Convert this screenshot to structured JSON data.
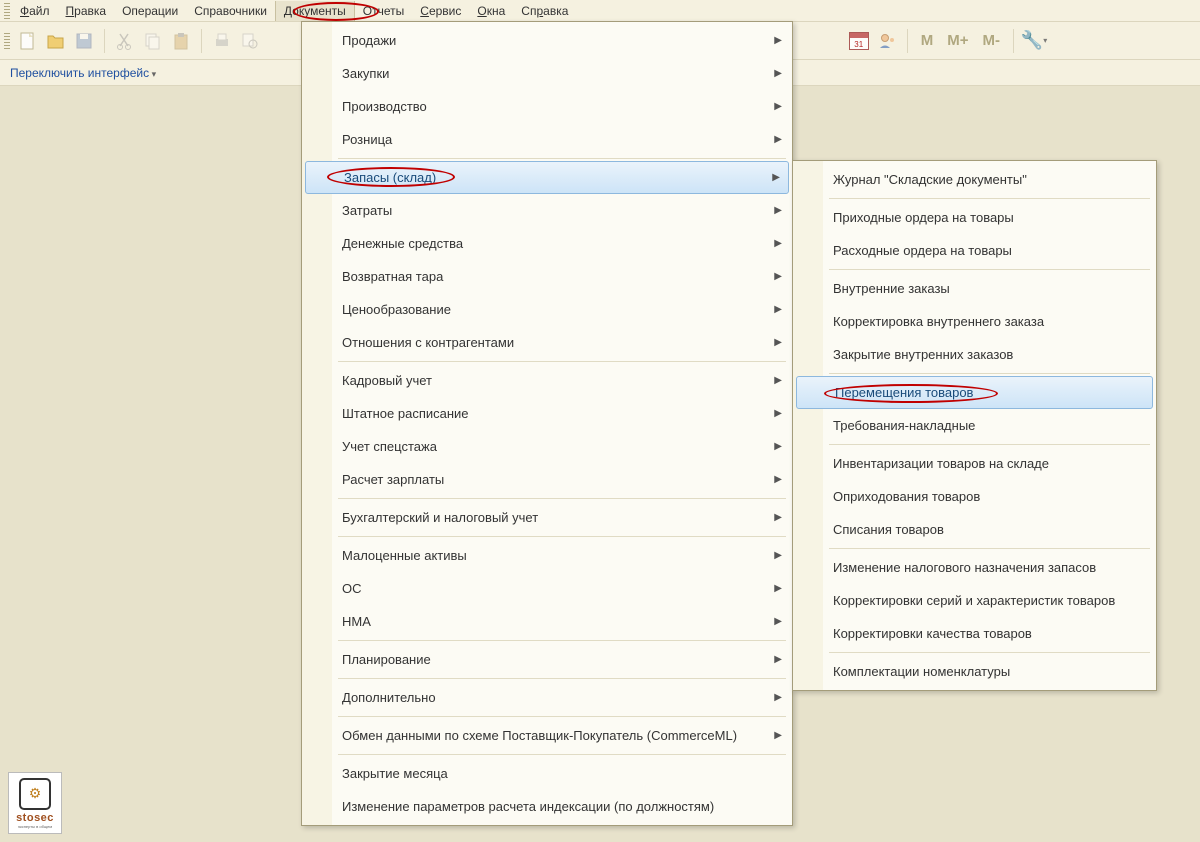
{
  "menubar": {
    "items": [
      {
        "label": "Файл",
        "u": 0
      },
      {
        "label": "Правка",
        "u": 0
      },
      {
        "label": "Операции",
        "u": -1
      },
      {
        "label": "Справочники",
        "u": -1
      },
      {
        "label": "Документы",
        "u": 0,
        "open": true
      },
      {
        "label": "Отчеты",
        "u": -1
      },
      {
        "label": "Сервис",
        "u": 0
      },
      {
        "label": "Окна",
        "u": 0
      },
      {
        "label": "Справка",
        "u": 2
      }
    ]
  },
  "toolbar": {
    "icons": [
      "new-doc",
      "open-folder",
      "save-disk",
      "sep",
      "cut",
      "copy",
      "paste",
      "sep",
      "print",
      "print-preview"
    ],
    "calendar_day": "31",
    "m_buttons": [
      "M",
      "M+",
      "M-"
    ]
  },
  "switcher": {
    "label": "Переключить интерфейс"
  },
  "dropdown": {
    "items": [
      {
        "label": "Продажи",
        "sub": true
      },
      {
        "label": "Закупки",
        "sub": true
      },
      {
        "label": "Производство",
        "sub": true
      },
      {
        "label": "Розница",
        "sub": true
      },
      {
        "sep": true
      },
      {
        "label": "Запасы (склад)",
        "sub": true,
        "highlight": true,
        "oval": true
      },
      {
        "label": "Затраты",
        "sub": true
      },
      {
        "label": "Денежные средства",
        "sub": true
      },
      {
        "label": "Возвратная тара",
        "sub": true
      },
      {
        "label": "Ценообразование",
        "sub": true
      },
      {
        "label": "Отношения с контрагентами",
        "sub": true
      },
      {
        "sep": true
      },
      {
        "label": "Кадровый учет",
        "sub": true
      },
      {
        "label": "Штатное расписание",
        "sub": true
      },
      {
        "label": "Учет спецстажа",
        "sub": true
      },
      {
        "label": "Расчет зарплаты",
        "sub": true
      },
      {
        "sep": true
      },
      {
        "label": "Бухгалтерский и налоговый учет",
        "sub": true
      },
      {
        "sep": true
      },
      {
        "label": "Малоценные активы",
        "sub": true
      },
      {
        "label": "ОС",
        "sub": true
      },
      {
        "label": "НМА",
        "sub": true
      },
      {
        "sep": true
      },
      {
        "label": "Планирование",
        "sub": true
      },
      {
        "sep": true
      },
      {
        "label": "Дополнительно",
        "sub": true
      },
      {
        "sep": true
      },
      {
        "label": "Обмен данными по схеме Поставщик-Покупатель (CommerceML)",
        "sub": true
      },
      {
        "sep": true
      },
      {
        "label": "Закрытие месяца"
      },
      {
        "label": "Изменение параметров расчета индексации (по должностям)"
      }
    ]
  },
  "submenu": {
    "items": [
      {
        "label": "Журнал \"Складские документы\""
      },
      {
        "sep": true
      },
      {
        "label": "Приходные ордера на товары"
      },
      {
        "label": "Расходные ордера на товары"
      },
      {
        "sep": true
      },
      {
        "label": "Внутренние заказы"
      },
      {
        "label": "Корректировка внутреннего заказа"
      },
      {
        "label": "Закрытие внутренних заказов"
      },
      {
        "sep": true
      },
      {
        "label": "Перемещения товаров",
        "highlight": true,
        "oval": true
      },
      {
        "label": "Требования-накладные"
      },
      {
        "sep": true
      },
      {
        "label": "Инвентаризации товаров на складе"
      },
      {
        "label": "Оприходования товаров"
      },
      {
        "label": "Списания товаров"
      },
      {
        "sep": true
      },
      {
        "label": "Изменение налогового назначения запасов"
      },
      {
        "label": "Корректировки серий и характеристик товаров"
      },
      {
        "label": "Корректировки качества товаров"
      },
      {
        "sep": true
      },
      {
        "label": "Комплектации номенклатуры"
      }
    ]
  },
  "logo": {
    "text": "stosec"
  }
}
